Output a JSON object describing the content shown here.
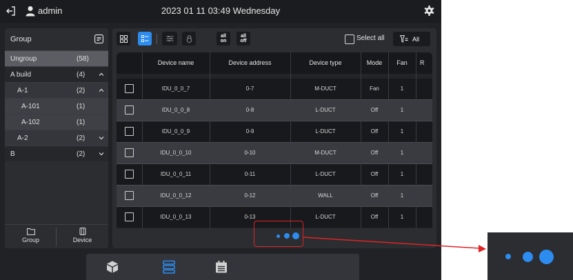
{
  "topbar": {
    "username": "admin",
    "datetime": "2023 01 11 03:49 Wednesday",
    "icons": [
      "logout-icon",
      "user-icon",
      "settings-gear-icon"
    ]
  },
  "sidebar": {
    "header_label": "Group",
    "items": [
      {
        "name": "Ungroup",
        "count": "(58)",
        "selected": true
      },
      {
        "name": "A build",
        "count": "(4)",
        "chevron": "up"
      },
      {
        "name": "A-1",
        "count": "(2)",
        "chevron": "up"
      },
      {
        "name": "A-101",
        "count": "(1)"
      },
      {
        "name": "A-102",
        "count": "(1)"
      },
      {
        "name": "A-2",
        "count": "(2)",
        "chevron": "down"
      },
      {
        "name": "B",
        "count": "(2)",
        "chevron": "down"
      }
    ],
    "bottom_buttons": {
      "group": "Group",
      "device": "Device"
    }
  },
  "toolbar": {
    "all_on": "all on",
    "all_off": "all off",
    "select_all": "Select all",
    "filter_label": "All"
  },
  "table": {
    "columns": [
      "Device name",
      "Device address",
      "Device type",
      "Mode",
      "Fan",
      "R"
    ],
    "rows": [
      {
        "name": "IDU_0_0_7",
        "address": "0-7",
        "type": "M-DUCT",
        "mode": "Fan",
        "fan": "1"
      },
      {
        "name": "IDU_0_0_8",
        "address": "0-8",
        "type": "L-DUCT",
        "mode": "Off",
        "fan": "1"
      },
      {
        "name": "IDU_0_0_9",
        "address": "0-9",
        "type": "L-DUCT",
        "mode": "Off",
        "fan": "1"
      },
      {
        "name": "IDU_0_0_10",
        "address": "0-10",
        "type": "M-DUCT",
        "mode": "Off",
        "fan": "1"
      },
      {
        "name": "IDU_0_0_11",
        "address": "0-11",
        "type": "L-DUCT",
        "mode": "Off",
        "fan": "1"
      },
      {
        "name": "IDU_0_0_12",
        "address": "0-12",
        "type": "WALL",
        "mode": "Off",
        "fan": "1"
      },
      {
        "name": "IDU_0_0_13",
        "address": "0-13",
        "type": "L-DUCT",
        "mode": "Off",
        "fan": "1"
      }
    ]
  },
  "dock": {
    "icons": [
      "device-cube-icon",
      "device-list-icon",
      "schedule-calendar-icon"
    ],
    "active": "device-list-icon"
  },
  "colors": {
    "accent": "#2d8cf0",
    "highlight": "#e02424",
    "background": "#202225"
  }
}
